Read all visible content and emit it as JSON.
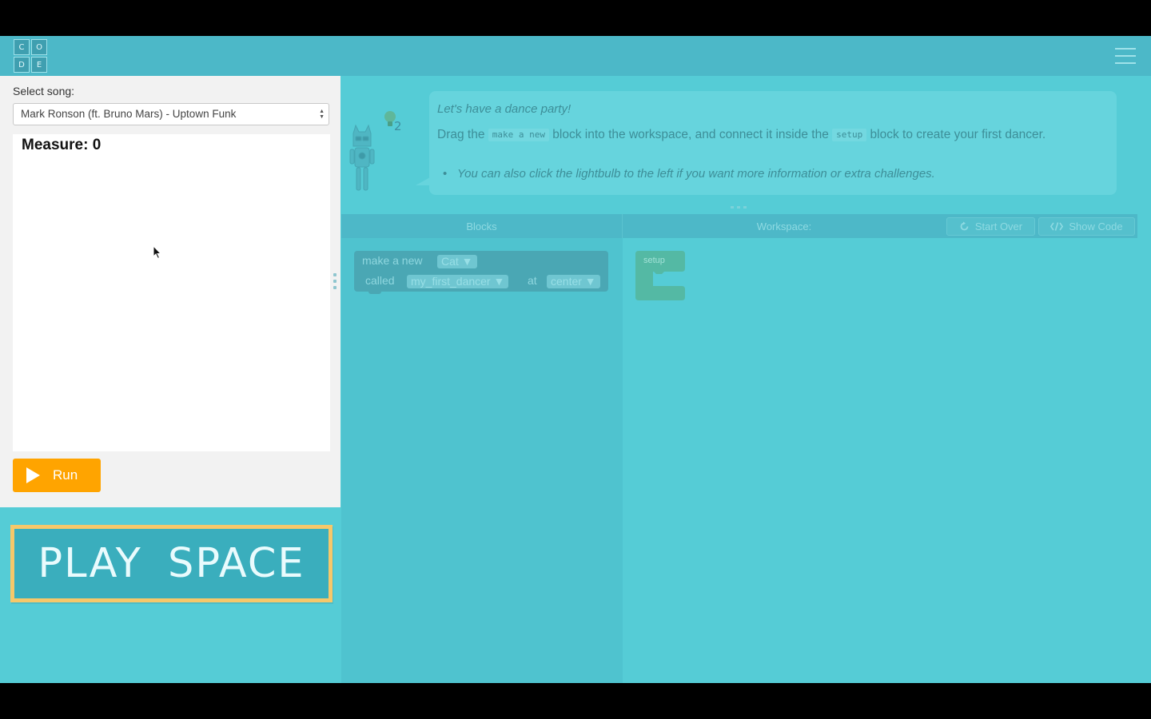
{
  "logo": {
    "letters": [
      "C",
      "O",
      "D",
      "E"
    ]
  },
  "colors": {
    "accent_run": "#ffa400",
    "app_background": "#55ccd6",
    "play_space_border": "#f6c86a",
    "setup_block": "#54b9a4",
    "make_block": "#4aa7b4"
  },
  "icons": {
    "menu": "hamburger-icon",
    "run": "play-icon",
    "start_over": "refresh-icon",
    "show_code": "code-icon",
    "hint": "lightbulb-icon"
  },
  "left_panel": {
    "song_label": "Select song:",
    "song_selected": "Mark Ronson (ft. Bruno Mars) - Uptown Funk",
    "measure_text": "Measure: 0",
    "run_label": "Run"
  },
  "play_space": {
    "label": "PLAY SPACE"
  },
  "instructions": {
    "hint_count": "2",
    "title": "Let's have a dance party!",
    "line1_before": "Drag the ",
    "chip_make": "make a new",
    "line1_middle": " block into the workspace, and connect it inside the ",
    "chip_setup": "setup",
    "line1_after": " block to create your first dancer.",
    "bullet": "You can also click the lightbulb to the left if you want more information or extra challenges."
  },
  "toolbar": {
    "blocks_label": "Blocks",
    "workspace_label": "Workspace:",
    "start_over_label": "Start Over",
    "show_code_label": "Show Code"
  },
  "toolbox": {
    "make_block": {
      "make_text": "make a new",
      "character_value": "Cat ▼",
      "called_text": "called",
      "name_value": "my_first_dancer ▼",
      "at_text": "at",
      "location_value": "center ▼"
    }
  },
  "workspace": {
    "setup_label": "setup"
  }
}
